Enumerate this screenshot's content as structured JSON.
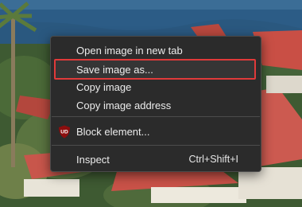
{
  "context_menu": {
    "items": [
      {
        "label": "Open image in new tab"
      },
      {
        "label": "Save image as..."
      },
      {
        "label": "Copy image"
      },
      {
        "label": "Copy image address"
      },
      {
        "label": "Block element...",
        "icon": "ublock-origin-icon",
        "icon_text": "UD"
      },
      {
        "label": "Inspect",
        "shortcut": "Ctrl+Shift+I"
      }
    ],
    "highlighted_item": "Save image as...",
    "highlight_color": "#e03a3a"
  },
  "colors": {
    "menu_background": "#2b2b2b",
    "menu_text": "#ececec"
  }
}
